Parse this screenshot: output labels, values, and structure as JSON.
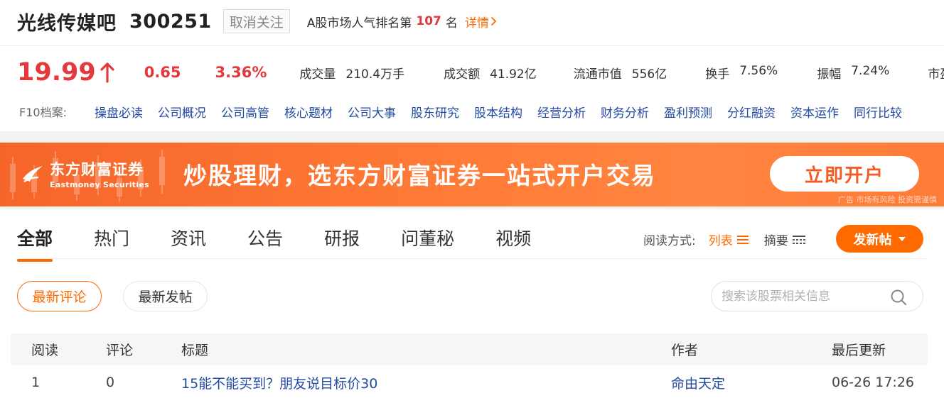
{
  "header": {
    "stock_name": "光线传媒吧",
    "stock_code": "300251",
    "unfollow_label": "取消关注",
    "rank_prefix": "A股市场人气排名第",
    "rank_value": "107",
    "rank_suffix": "名",
    "detail_label": "详情"
  },
  "quote": {
    "price": "19.99",
    "change": "0.65",
    "change_pct": "3.36%",
    "metrics": [
      {
        "label": "成交量",
        "value": "210.4万手"
      },
      {
        "label": "成交额",
        "value": "41.92亿"
      },
      {
        "label": "流通市值",
        "value": "556亿"
      },
      {
        "label": "换手",
        "value": "7.56%"
      },
      {
        "label": "振幅",
        "value": "7.24%"
      },
      {
        "label": "市盈",
        "value": ""
      }
    ]
  },
  "f10": {
    "label": "F10档案:",
    "links": [
      "操盘必读",
      "公司概况",
      "公司高管",
      "核心题材",
      "公司大事",
      "股东研究",
      "股本结构",
      "经营分析",
      "财务分析",
      "盈利预测",
      "分红融资",
      "资本运作",
      "同行比较"
    ]
  },
  "banner": {
    "brand_cn": "东方财富证券",
    "brand_en": "Eastmoney Securities",
    "slogan": "炒股理财，选东方财富证券一站式开户交易",
    "button_label": "立即开户",
    "ad_note": "广告 市场有风险 投资需谨慎"
  },
  "tabs": [
    "全部",
    "热门",
    "资讯",
    "公告",
    "研报",
    "问董秘",
    "视频"
  ],
  "read_mode": {
    "label": "阅读方式:",
    "list_label": "列表",
    "summary_label": "摘要"
  },
  "post_button_label": "发新帖",
  "sort": {
    "latest_comment": "最新评论",
    "latest_post": "最新发帖"
  },
  "search": {
    "placeholder": "搜索该股票相关信息",
    "value": ""
  },
  "table": {
    "headers": {
      "read": "阅读",
      "comment": "评论",
      "title": "标题",
      "author": "作者",
      "updated": "最后更新"
    },
    "rows": [
      {
        "read": "1",
        "comment": "0",
        "title": "15能不能买到？朋友说目标价30",
        "author": "命由天定",
        "updated": "06-26 17:26"
      }
    ]
  },
  "colors": {
    "accent": "#ff6a00",
    "price_up": "#e4393c",
    "link": "#234aa3"
  }
}
